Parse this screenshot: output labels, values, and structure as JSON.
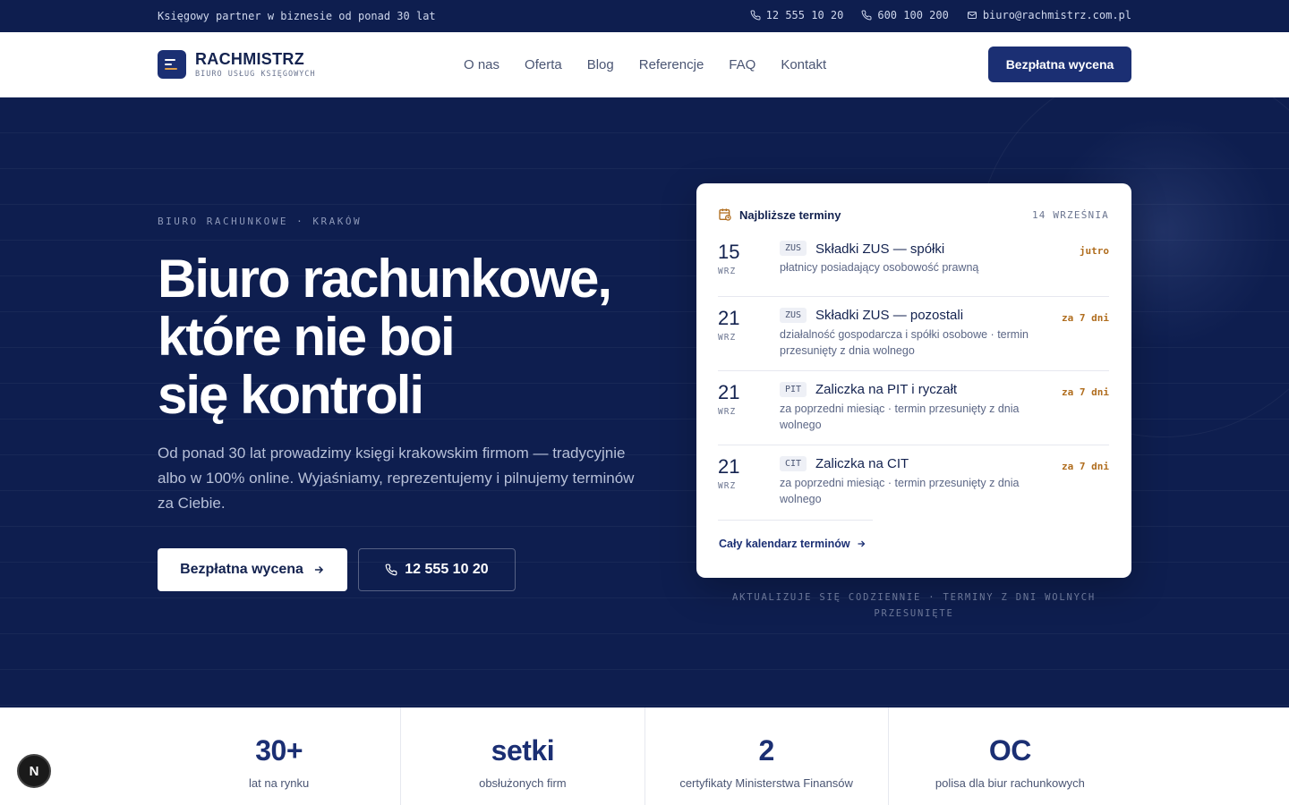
{
  "topbar": {
    "tagline": "Księgowy partner w biznesie od ponad 30 lat",
    "phone1": "12 555 10 20",
    "phone2": "600 100 200",
    "email": "biuro@rachmistrz.com.pl"
  },
  "header": {
    "logo_name": "RACHMISTRZ",
    "logo_sub": "BIURO USŁUG KSIĘGOWYCH",
    "nav": [
      "O nas",
      "Oferta",
      "Blog",
      "Referencje",
      "FAQ",
      "Kontakt"
    ],
    "cta": "Bezpłatna wycena"
  },
  "hero": {
    "eyebrow": "BIURO RACHUNKOWE · KRAKÓW",
    "headline": [
      "Biuro rachunkowe,",
      "które nie boi",
      "się kontroli"
    ],
    "lead": "Od ponad 30 lat prowadzimy księgi krakowskim firmom — tradycyjnie albo w 100% online. Wyjaśniamy, reprezentujemy i pilnujemy terminów za Ciebie.",
    "primary_button": "Bezpłatna wycena",
    "secondary_button": "12 555 10 20"
  },
  "deadlines": {
    "title": "Najbliższe terminy",
    "date": "14 WRZEŚNIA",
    "items": [
      {
        "day": "15",
        "month": "WRZ",
        "tag": "ZUS",
        "title": "Składki ZUS — spółki",
        "desc": "płatnicy posiadający osobowość prawną",
        "due": "jutro"
      },
      {
        "day": "21",
        "month": "WRZ",
        "tag": "ZUS",
        "title": "Składki ZUS — pozostali",
        "desc": "działalność gospodarcza i spółki osobowe · termin przesunięty z dnia wolnego",
        "due": "za 7 dni"
      },
      {
        "day": "21",
        "month": "WRZ",
        "tag": "PIT",
        "title": "Zaliczka na PIT i ryczałt",
        "desc": "za poprzedni miesiąc · termin przesunięty z dnia wolnego",
        "due": "za 7 dni"
      },
      {
        "day": "21",
        "month": "WRZ",
        "tag": "CIT",
        "title": "Zaliczka na CIT",
        "desc": "za poprzedni miesiąc · termin przesunięty z dnia wolnego",
        "due": "za 7 dni"
      }
    ],
    "link": "Cały kalendarz terminów",
    "note": "AKTUALIZUJE SIĘ CODZIENNIE · TERMINY Z DNI WOLNYCH PRZESUNIĘTE"
  },
  "stats": [
    {
      "num": "30+",
      "label": "lat na rynku"
    },
    {
      "num": "setki",
      "label": "obsłużonych firm"
    },
    {
      "num": "2",
      "label": "certyfikaty Ministerstwa Finansów"
    },
    {
      "num": "OC",
      "label": "polisa dla biur rachunkowych"
    }
  ],
  "badge": "N",
  "colors": {
    "navy": "#0e1e4f",
    "accent": "#1b2f73",
    "due": "#b06d1e"
  }
}
